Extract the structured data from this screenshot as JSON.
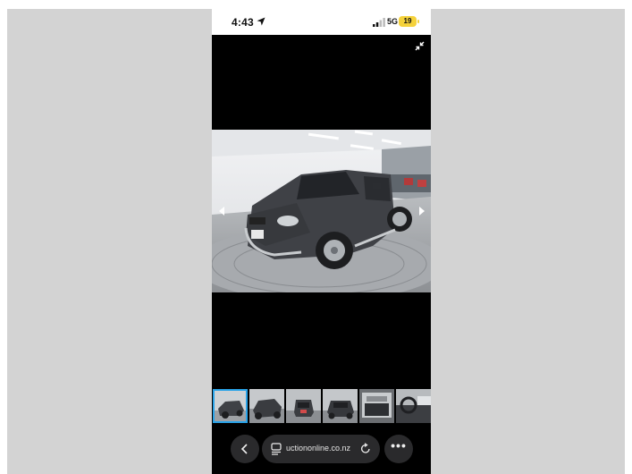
{
  "status_bar": {
    "time": "4:43",
    "network": "5G",
    "battery": "19",
    "icons": [
      "location-arrow-icon",
      "signal-icon"
    ]
  },
  "viewer": {
    "icons": [
      "collapse-icon",
      "prev-arrow-icon",
      "next-arrow-icon"
    ],
    "main_photo": "car-photo",
    "thumbnail_count": 6,
    "active_thumbnail": 1
  },
  "browser": {
    "url_text": "uctiononline.co.nz",
    "icons": [
      "back-chevron-icon",
      "tabs-icon",
      "reload-icon",
      "more-icon"
    ],
    "more_label": "•••"
  },
  "colors": {
    "backdrop": "#d3d3d3",
    "battery": "#f5d23b",
    "thumb_highlight": "#2aa3e8",
    "car_body": "#3f4146"
  }
}
